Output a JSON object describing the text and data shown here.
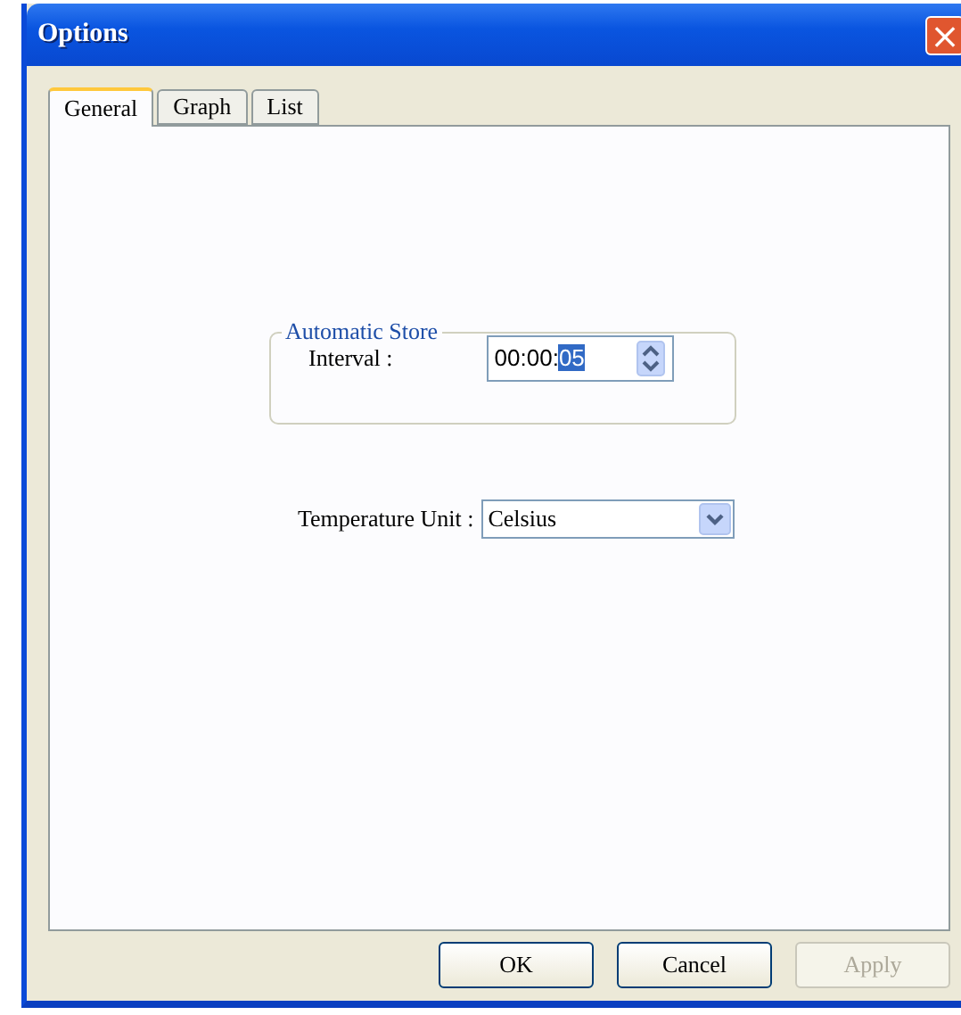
{
  "window": {
    "title": "Options",
    "close": "×"
  },
  "tabs": [
    {
      "label": "General",
      "selected": true
    },
    {
      "label": "Graph",
      "selected": false
    },
    {
      "label": "List",
      "selected": false
    }
  ],
  "automatic_store": {
    "title": "Automatic Store",
    "interval_label": "Interval :",
    "interval_value": [
      {
        "text": "00:00:",
        "selected": false
      },
      {
        "text": "05",
        "selected": true
      }
    ]
  },
  "temperature_unit": {
    "label": "Temperature Unit :",
    "value": "Celsius"
  },
  "buttons": [
    {
      "label": "OK",
      "disabled": false
    },
    {
      "label": "Cancel",
      "disabled": false
    },
    {
      "label": "Apply",
      "disabled": true
    }
  ]
}
